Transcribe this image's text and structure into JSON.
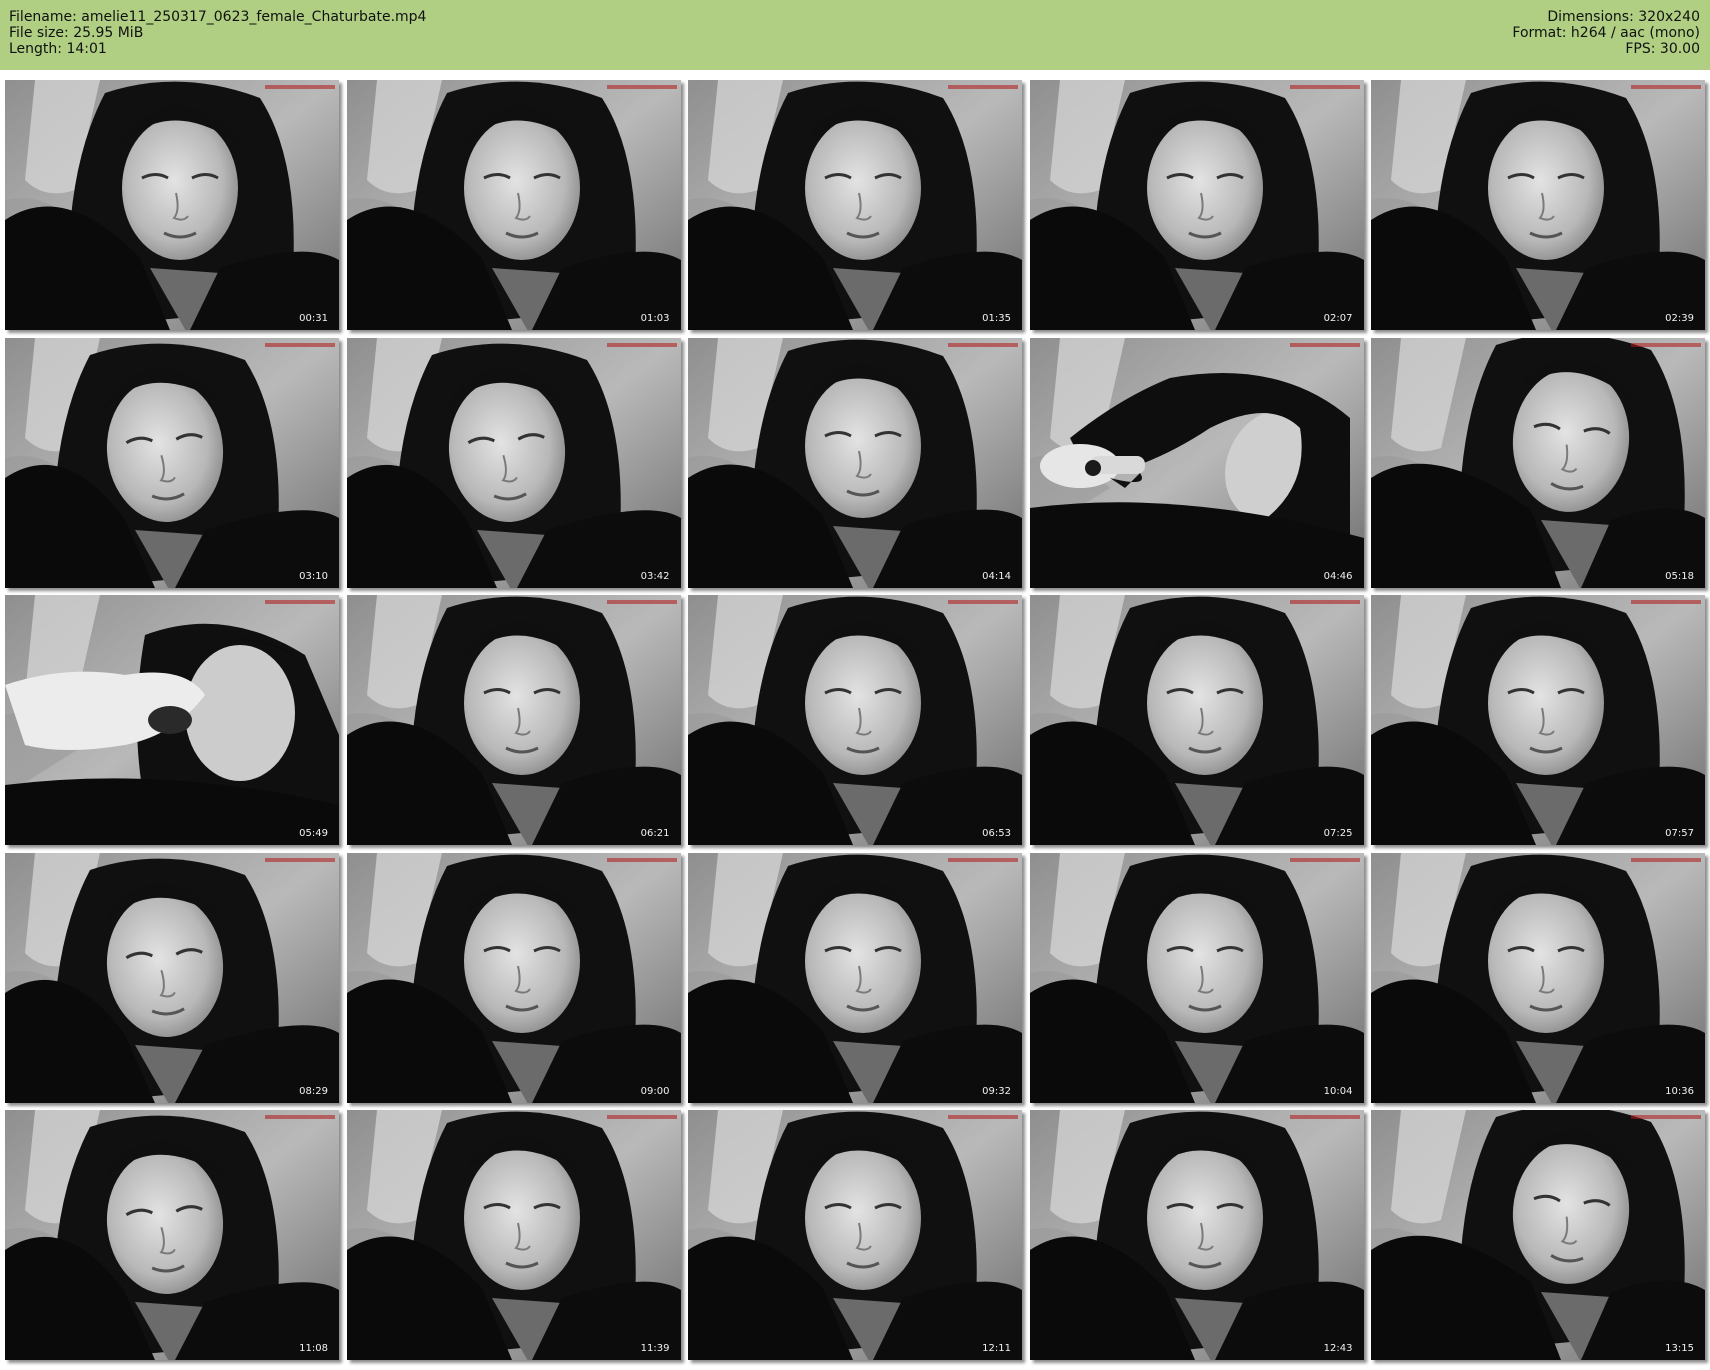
{
  "header": {
    "filename": "Filename: amelie11_250317_0623_female_Chaturbate.mp4",
    "file_size": "File size: 25.95 MiB",
    "length": "Length: 14:01",
    "dimensions": "Dimensions: 320x240",
    "format": "Format: h264 / aac (mono)",
    "fps": "FPS: 30.00",
    "background_color": "#b0cf82"
  },
  "thumbnails": [
    {
      "time": "00:31",
      "variant": "face-center"
    },
    {
      "time": "01:03",
      "variant": "face-center"
    },
    {
      "time": "01:35",
      "variant": "face-center"
    },
    {
      "time": "02:07",
      "variant": "face-center"
    },
    {
      "time": "02:39",
      "variant": "face-center"
    },
    {
      "time": "03:10",
      "variant": "face-left"
    },
    {
      "time": "03:42",
      "variant": "face-left"
    },
    {
      "time": "04:14",
      "variant": "face-center"
    },
    {
      "time": "04:46",
      "variant": "lying-hand"
    },
    {
      "time": "05:18",
      "variant": "face-right"
    },
    {
      "time": "05:49",
      "variant": "hand-face"
    },
    {
      "time": "06:21",
      "variant": "face-center"
    },
    {
      "time": "06:53",
      "variant": "face-center"
    },
    {
      "time": "07:25",
      "variant": "face-center"
    },
    {
      "time": "07:57",
      "variant": "face-center"
    },
    {
      "time": "08:29",
      "variant": "face-left"
    },
    {
      "time": "09:00",
      "variant": "face-center"
    },
    {
      "time": "09:32",
      "variant": "face-center"
    },
    {
      "time": "10:04",
      "variant": "face-center"
    },
    {
      "time": "10:36",
      "variant": "face-center"
    },
    {
      "time": "11:08",
      "variant": "face-left"
    },
    {
      "time": "11:39",
      "variant": "face-center"
    },
    {
      "time": "12:11",
      "variant": "face-center"
    },
    {
      "time": "12:43",
      "variant": "face-center"
    },
    {
      "time": "13:15",
      "variant": "face-right"
    }
  ]
}
